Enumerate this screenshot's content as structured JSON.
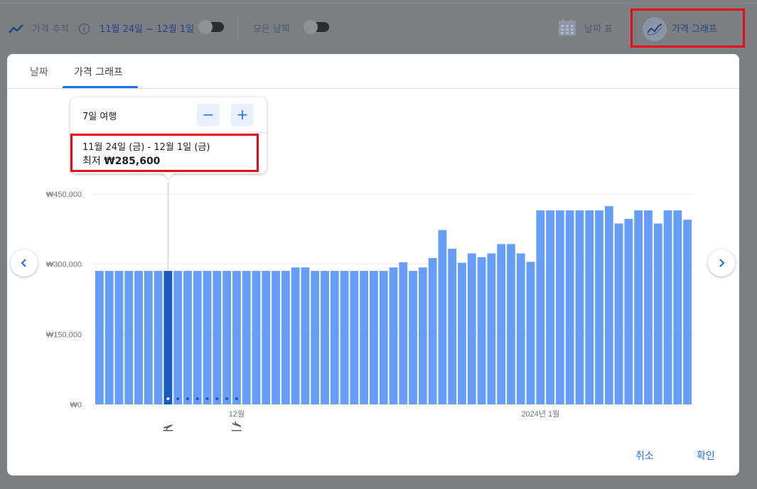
{
  "topbar": {
    "track_label": "가격 추적",
    "track_dates": "11월 24일 ~ 12월 1일",
    "all_dates_label": "모든 날짜",
    "date_grid_label": "날짜 표",
    "price_graph_label": "가격 그래프",
    "icons": {
      "track": "trend-line-icon",
      "info": "info-icon",
      "calendar": "calendar-grid-icon",
      "graph": "price-graph-icon"
    }
  },
  "dialog": {
    "tabs": [
      {
        "label": "날짜",
        "active": false
      },
      {
        "label": "가격 그래프",
        "active": true
      }
    ],
    "tooltip": {
      "trip_length": "7일 여행",
      "minus_symbol": "−",
      "plus_symbol": "+",
      "dates": "11월 24일 (금) - 12월 1일 (금)",
      "price_prefix": "최저 ",
      "price_value": "₩285,600"
    },
    "cancel_label": "취소",
    "confirm_label": "확인"
  },
  "colors": {
    "bar": "#669df6",
    "bar_selected": "#185abc",
    "accent": "#1a73e8",
    "highlight_box": "#e30b17"
  },
  "chart_data": {
    "type": "bar",
    "ylim": [
      0,
      450000
    ],
    "yticks": [
      {
        "value": 0,
        "label": "₩0"
      },
      {
        "value": 150000,
        "label": "₩150,000"
      },
      {
        "value": 300000,
        "label": "₩300,000"
      },
      {
        "value": 450000,
        "label": "₩450,000"
      }
    ],
    "xtick_labels": [
      {
        "index": 14,
        "label": "12월"
      },
      {
        "index": 45,
        "label": "2024년 1월"
      }
    ],
    "selected_index": 7,
    "trip_dot_count": 8,
    "values": [
      285600,
      285600,
      285600,
      285600,
      285600,
      285600,
      285600,
      285600,
      285600,
      285600,
      285600,
      285600,
      285600,
      285600,
      285600,
      285600,
      285600,
      285600,
      285600,
      285600,
      293000,
      293000,
      285600,
      285600,
      285600,
      285600,
      285600,
      285600,
      285600,
      285600,
      293000,
      304000,
      285600,
      293000,
      313000,
      373000,
      333000,
      303000,
      323000,
      315000,
      323000,
      343000,
      343000,
      323000,
      305000,
      415000,
      415000,
      415000,
      415000,
      415000,
      415000,
      415000,
      424000,
      387000,
      397000,
      415000,
      415000,
      387000,
      415000,
      415000,
      395000
    ],
    "grid": true,
    "legend": "none"
  }
}
